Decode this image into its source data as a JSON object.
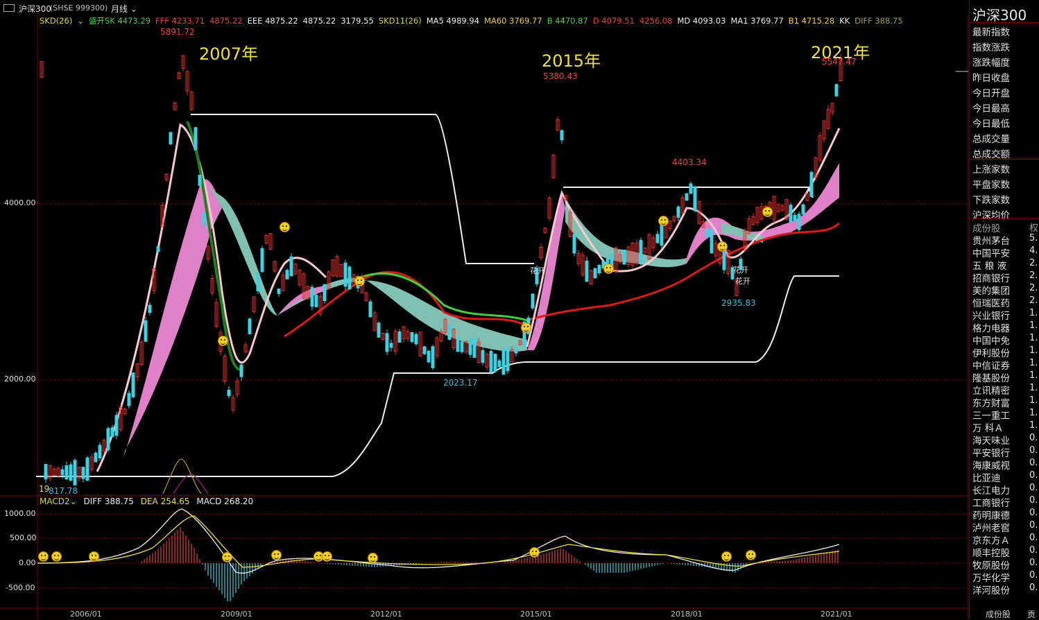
{
  "window": {
    "menu_icon": "window-menu-icon",
    "title": "沪深300",
    "code": "(SHSE 999300)",
    "period": "月线"
  },
  "indicator_line": [
    {
      "text": "SKD(26)",
      "color": "#d8d840"
    },
    {
      "text": "盛开SK 4473.29",
      "color": "#50c850"
    },
    {
      "text": "FFF 4233.71",
      "color": "#e84040"
    },
    {
      "text": "4875.22",
      "color": "#e84040"
    },
    {
      "text": "EEE 4875.22",
      "color": "#f0f0f0"
    },
    {
      "text": "4875.22",
      "color": "#f0f0f0"
    },
    {
      "text": "3179.55",
      "color": "#f0f0f0"
    },
    {
      "text": "SKD11(26)",
      "color": "#d8d840"
    },
    {
      "text": "MA5 4989.94",
      "color": "#f0f0f0"
    },
    {
      "text": "MA60 3769.77",
      "color": "#f0d040"
    },
    {
      "text": "B 4470.87",
      "color": "#50c850"
    },
    {
      "text": "D 4079.51",
      "color": "#e84040"
    },
    {
      "text": "4256.08",
      "color": "#e84040"
    },
    {
      "text": "MD 4093.03",
      "color": "#f0f0f0"
    },
    {
      "text": "MA1 3769.77",
      "color": "#f0f0f0"
    },
    {
      "text": "B1 4715.28",
      "color": "#f0d040"
    },
    {
      "text": "KK",
      "color": "#f0f0f0"
    },
    {
      "text": "DIFF 388.75",
      "color": "#a0a060"
    }
  ],
  "annotations": {
    "year_2007": "2007年",
    "year_2015": "2015年",
    "year_2021": "2021年",
    "peak_2007": "5891.72",
    "peak_2015": "5380.43",
    "peak_2018": "4403.34",
    "peak_2021": "5547.47",
    "low_2013": "2023.17",
    "low_2019": "2935.83",
    "low_2005": "817.78",
    "low_2005_prefix": "19",
    "flower_1": "花开",
    "flower_2": "花开",
    "flower_3": "花开"
  },
  "price_axis": {
    "high": "4000.00",
    "low": "2000.00"
  },
  "macd": {
    "name": "MACD2",
    "diff": "DIFF 388.75",
    "dea": "DEA 254.65",
    "macd": "MACD 268.20",
    "ticks": [
      "1000.00",
      "500.00",
      "0.00",
      "-500.00"
    ]
  },
  "x_axis": [
    "2006/01",
    "2009/01",
    "2012/01",
    "2015/01",
    "2018/01",
    "2021/01"
  ],
  "sidebar": {
    "title": "沪深300",
    "fields": [
      "最新指数",
      "指数涨跌",
      "涨跌幅度",
      "昨日收盘",
      "今日开盘",
      "今日最高",
      "今日最低",
      "总成交量",
      "总成交额",
      "上涨家数",
      "平盘家数",
      "下跌家数",
      "沪深均价"
    ],
    "constituent_header": "成份股",
    "weight_header": "权",
    "constituents": [
      {
        "name": "贵州茅台",
        "w": "5."
      },
      {
        "name": "中国平安",
        "w": "4."
      },
      {
        "name": "五 粮 液",
        "w": "2."
      },
      {
        "name": "招商银行",
        "w": "2."
      },
      {
        "name": "美的集团",
        "w": "2."
      },
      {
        "name": "恒瑞医药",
        "w": "2."
      },
      {
        "name": "兴业银行",
        "w": "1."
      },
      {
        "name": "格力电器",
        "w": "1."
      },
      {
        "name": "中国中免",
        "w": "1."
      },
      {
        "name": "伊利股份",
        "w": "1."
      },
      {
        "name": "中信证券",
        "w": "1."
      },
      {
        "name": "隆基股份",
        "w": "1."
      },
      {
        "name": "立讯精密",
        "w": "1."
      },
      {
        "name": "东方财富",
        "w": "1."
      },
      {
        "name": "三一重工",
        "w": "1."
      },
      {
        "name": "万 科Ａ",
        "w": "1."
      },
      {
        "name": "海天味业",
        "w": "0."
      },
      {
        "name": "平安银行",
        "w": "0."
      },
      {
        "name": "海康威视",
        "w": "0."
      },
      {
        "name": "比亚迪",
        "w": "0."
      },
      {
        "name": "长江电力",
        "w": "0."
      },
      {
        "name": "工商银行",
        "w": "0."
      },
      {
        "name": "药明康德",
        "w": "0."
      },
      {
        "name": "泸州老窖",
        "w": "0."
      },
      {
        "name": "京东方Ａ",
        "w": "0."
      },
      {
        "name": "顺丰控股",
        "w": "0."
      },
      {
        "name": "牧原股份",
        "w": "0."
      },
      {
        "name": "万华化学",
        "w": "0."
      },
      {
        "name": "洋河股份",
        "w": "0."
      }
    ],
    "tabs": [
      "成份股",
      "贡"
    ]
  }
}
